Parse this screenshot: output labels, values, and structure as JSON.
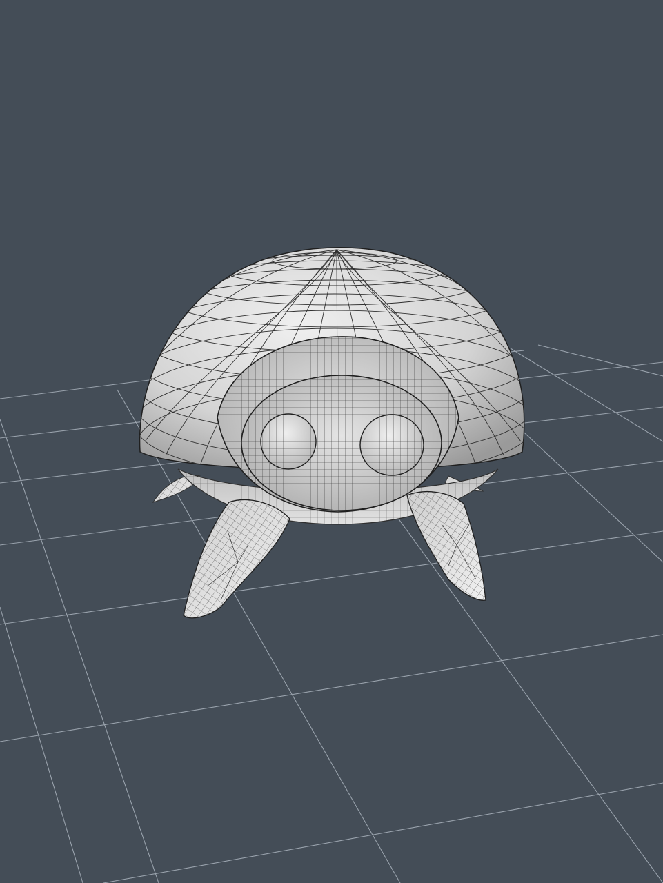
{
  "viewport": {
    "background": "#444d57",
    "grid_color": "#9aa3ad",
    "model": {
      "name": "wireframe-creature",
      "shell_fill": "#d2d2d2",
      "shell_fill_dark": "#a9a9a9",
      "mesh_color": "#2f2f2f",
      "leg_count": 4,
      "eye_count": 2
    }
  }
}
